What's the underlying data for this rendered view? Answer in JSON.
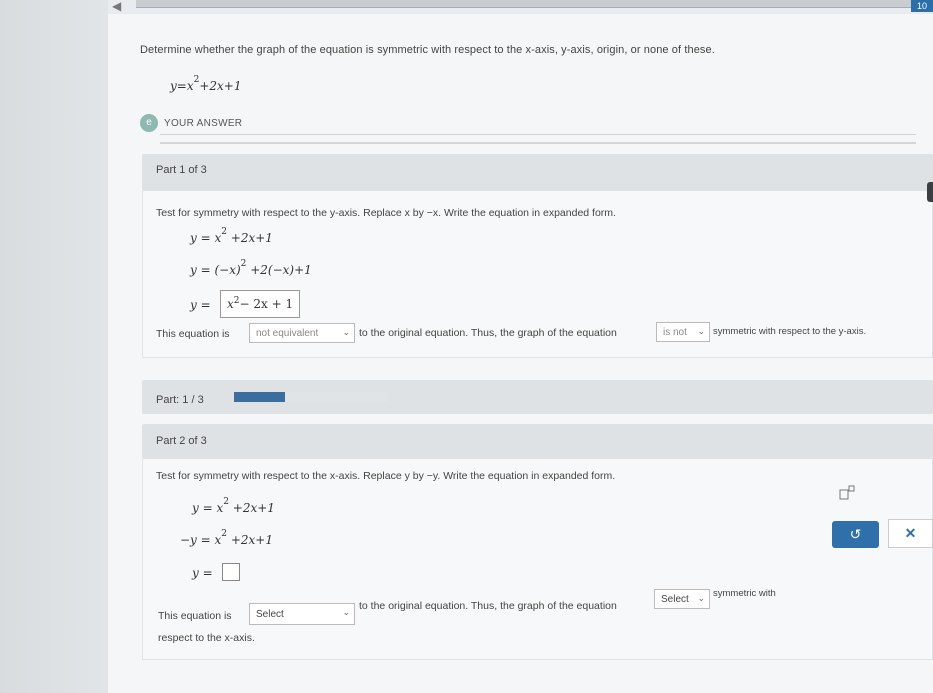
{
  "header": {
    "corner_badge": "10"
  },
  "question": {
    "prompt": "Determine whether the graph of the equation is symmetric with respect to the x-axis, y-axis, origin, or none of these.",
    "equation_lhs": "y=x",
    "equation_exp": "2",
    "equation_rhs": "+2x+1"
  },
  "your_answer": {
    "icon_label": "e",
    "label": "YOUR ANSWER"
  },
  "part1": {
    "header": "Part 1 of 3",
    "instruction": "Test for symmetry with respect to the y-axis. Replace x by −x. Write the equation in expanded form.",
    "line1_lhs": "y = x",
    "line1_exp": "2",
    "line1_rhs": " +2x+1",
    "line2_lhs": "y = (−x)",
    "line2_exp": "2",
    "line2_rhs": " +2(−x)+1",
    "line3_lhs": "y =",
    "answer_base": "x",
    "answer_exp": "2",
    "answer_rest": " − 2x + 1",
    "sentence_start": "This equation is",
    "dropdown1": "not equivalent",
    "sentence_mid": "to the original equation. Thus, the graph of the equation",
    "dropdown2": "is not",
    "sentence_end": "symmetric with respect to the y-axis."
  },
  "progress": {
    "label": "Part: 1 / 3",
    "fraction": 0.333
  },
  "part2": {
    "header": "Part 2 of 3",
    "instruction": "Test for symmetry with respect to the x-axis. Replace y by −y. Write the equation in expanded form.",
    "line1_lhs": "y = x",
    "line1_exp": "2",
    "line1_rhs": " +2x+1",
    "line2_lhs": "−y = x",
    "line2_exp": "2",
    "line2_rhs": " +2x+1",
    "line3_lhs": "y =",
    "sentence_start": "This equation is",
    "dropdown1": "Select",
    "sentence_mid": "to the original equation. Thus, the graph of the equation",
    "dropdown2": "Select",
    "sentence_end": "symmetric with",
    "sentence_tail": "respect to the x-axis."
  },
  "tools": {
    "superscript_icon": "superscript-icon",
    "undo_icon": "undo-icon",
    "undo_glyph": "↺",
    "clear_glyph": "✕"
  },
  "colors": {
    "accent": "#2f6faa",
    "progress": "#3b6e9e"
  }
}
